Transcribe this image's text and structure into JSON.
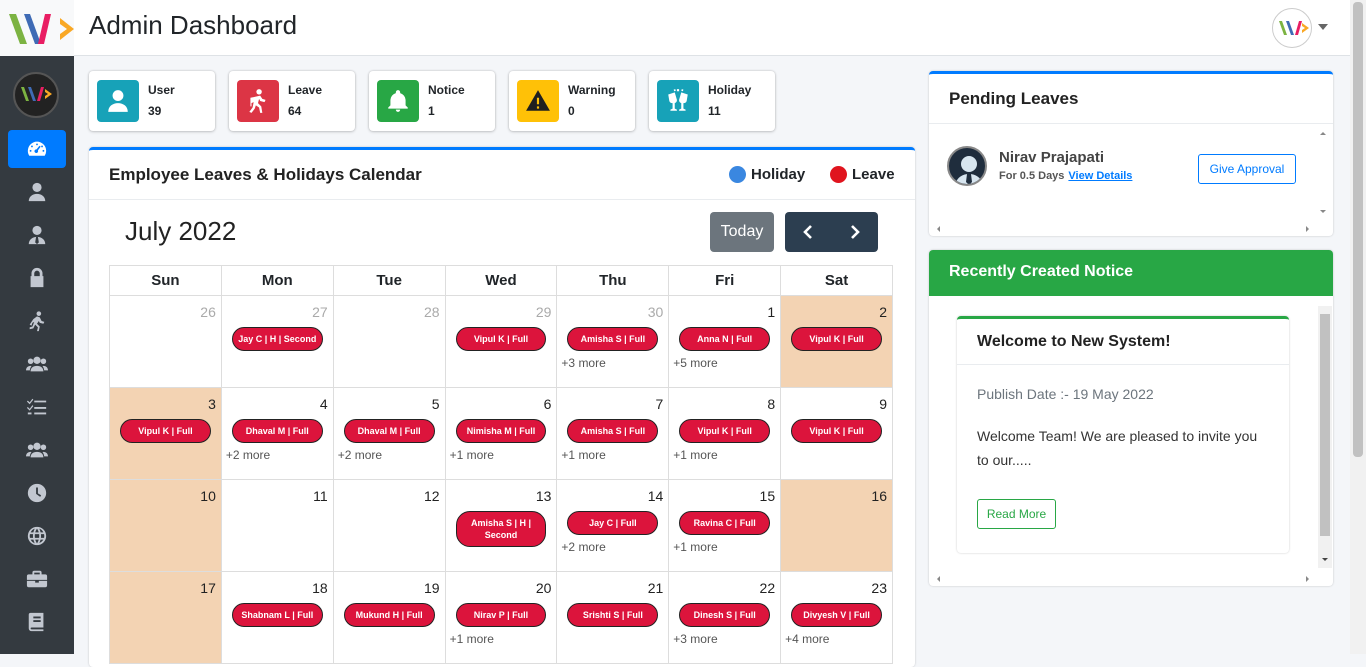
{
  "header": {
    "title": "Admin Dashboard"
  },
  "sidebar": {
    "items": [
      {
        "icon": "dashboard-icon",
        "active": true
      },
      {
        "icon": "user-icon"
      },
      {
        "icon": "user-tie-icon"
      },
      {
        "icon": "lock-icon"
      },
      {
        "icon": "running-person-icon"
      },
      {
        "icon": "users-icon"
      },
      {
        "icon": "list-check-icon"
      },
      {
        "icon": "users-group-icon"
      },
      {
        "icon": "clock-icon"
      },
      {
        "icon": "globe-icon"
      },
      {
        "icon": "briefcase-icon"
      },
      {
        "icon": "book-icon"
      }
    ]
  },
  "stats": [
    {
      "label": "User",
      "value": "39",
      "color": "#17a2b8",
      "icon": "user-icon"
    },
    {
      "label": "Leave",
      "value": "64",
      "color": "#dc3545",
      "icon": "walking-icon"
    },
    {
      "label": "Notice",
      "value": "1",
      "color": "#28a745",
      "icon": "bell-icon"
    },
    {
      "label": "Warning",
      "value": "0",
      "color": "#ffc107",
      "icon": "warning-icon"
    },
    {
      "label": "Holiday",
      "value": "11",
      "color": "#17a2b8",
      "icon": "cheers-icon"
    }
  ],
  "calendar": {
    "title": "Employee Leaves & Holidays Calendar",
    "legend": [
      {
        "label": "Holiday",
        "color": "#3a87e0"
      },
      {
        "label": "Leave",
        "color": "#e0141e"
      }
    ],
    "month": "July 2022",
    "today_label": "Today",
    "weekdays": [
      "Sun",
      "Mon",
      "Tue",
      "Wed",
      "Thu",
      "Fri",
      "Sat"
    ],
    "weeks": [
      [
        {
          "day": "26",
          "other": true
        },
        {
          "day": "27",
          "other": true,
          "event": "Jay C | H | Second"
        },
        {
          "day": "28",
          "other": true
        },
        {
          "day": "29",
          "other": true,
          "event": "Vipul K | Full"
        },
        {
          "day": "30",
          "other": true,
          "event": "Amisha S | Full",
          "more": "+3 more"
        },
        {
          "day": "1",
          "event": "Anna N | Full",
          "more": "+5 more"
        },
        {
          "day": "2",
          "weekend": true,
          "event": "Vipul K | Full"
        }
      ],
      [
        {
          "day": "3",
          "weekend": true,
          "event": "Vipul K | Full"
        },
        {
          "day": "4",
          "event": "Dhaval M | Full",
          "more": "+2 more"
        },
        {
          "day": "5",
          "event": "Dhaval M | Full",
          "more": "+2 more"
        },
        {
          "day": "6",
          "event": "Nimisha M | Full",
          "more": "+1 more"
        },
        {
          "day": "7",
          "event": "Amisha S | Full",
          "more": "+1 more"
        },
        {
          "day": "8",
          "event": "Vipul K | Full",
          "more": "+1 more"
        },
        {
          "day": "9",
          "event": "Vipul K | Full"
        }
      ],
      [
        {
          "day": "10",
          "weekend": true
        },
        {
          "day": "11"
        },
        {
          "day": "12"
        },
        {
          "day": "13",
          "event": "Amisha S | H | Second"
        },
        {
          "day": "14",
          "event": "Jay C | Full",
          "more": "+2 more"
        },
        {
          "day": "15",
          "event": "Ravina C | Full",
          "more": "+1 more"
        },
        {
          "day": "16",
          "weekend": true
        }
      ],
      [
        {
          "day": "17",
          "weekend": true
        },
        {
          "day": "18",
          "event": "Shabnam L | Full"
        },
        {
          "day": "19",
          "event": "Mukund H | Full"
        },
        {
          "day": "20",
          "event": "Nirav P | Full",
          "more": "+1 more"
        },
        {
          "day": "21",
          "event": "Srishti S | Full"
        },
        {
          "day": "22",
          "event": "Dinesh S | Full",
          "more": "+3 more"
        },
        {
          "day": "23",
          "event": "Divyesh V | Full",
          "more": "+4 more"
        }
      ]
    ]
  },
  "pending": {
    "title": "Pending Leaves",
    "name": "Nirav Prajapati",
    "days": "For 0.5 Days",
    "details_link": "View Details",
    "approve_label": "Give Approval"
  },
  "notice": {
    "title": "Recently Created Notice",
    "item_title": "Welcome to New System!",
    "publish": "Publish Date :- 19 May 2022",
    "body": "Welcome Team! We are pleased to invite you to our.....",
    "read_more": "Read More"
  },
  "colors": {
    "primary": "#007bff",
    "success": "#28a745",
    "sidebar": "#343a40",
    "weekend": "#f3d3b3"
  }
}
